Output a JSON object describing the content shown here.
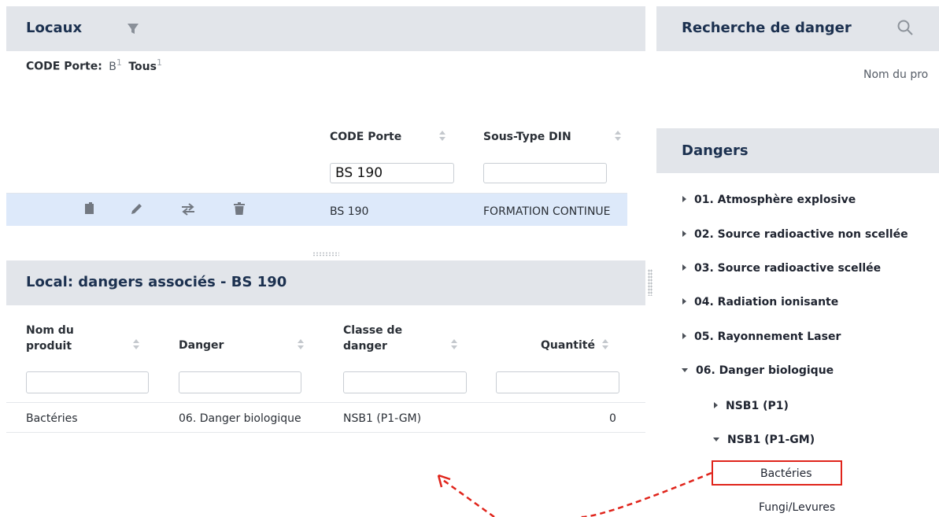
{
  "locaux": {
    "title": "Locaux",
    "icon": "filter-icon",
    "filter_label": "CODE Porte:",
    "filter_value": "B",
    "filter_value_count": "1",
    "filter_tous": "Tous",
    "filter_tous_count": "1",
    "columns": [
      {
        "label": "CODE Porte",
        "filter": "BS 190"
      },
      {
        "label": "Sous-Type DIN",
        "filter": ""
      }
    ],
    "row": {
      "icons": [
        "copy-icon",
        "edit-icon",
        "transfer-icon",
        "delete-icon"
      ],
      "code_porte": "BS 190",
      "sous_type": "FORMATION CONTINUE"
    }
  },
  "dangers_associes": {
    "title": "Local: dangers associés - BS 190",
    "columns": [
      {
        "label_line1": "Nom du",
        "label_line2": "produit"
      },
      {
        "label_line1": "Danger",
        "label_line2": ""
      },
      {
        "label_line1": "Classe de",
        "label_line2": "danger"
      },
      {
        "label_line1": "Quantité",
        "label_line2": ""
      }
    ],
    "row": {
      "nom": "Bactéries",
      "danger": "06. Danger biologique",
      "classe": "NSB1 (P1-GM)",
      "quantite": "0"
    }
  },
  "recherche": {
    "title": "Recherche de danger",
    "icon": "search-icon",
    "hint": "Nom du pro"
  },
  "dangers": {
    "title": "Dangers",
    "items": [
      "01. Atmosphère explosive",
      "02. Source radioactive non scellée",
      "03. Source radioactive scellée",
      "04. Radiation ionisante",
      "05. Rayonnement Laser",
      "06. Danger biologique"
    ],
    "sub_items": [
      "NSB1 (P1)",
      "NSB1 (P1-GM)"
    ],
    "leaves": [
      "Bactéries",
      "Fungi/Levures"
    ]
  },
  "annotation": {
    "highlight_color": "#e0241b"
  }
}
